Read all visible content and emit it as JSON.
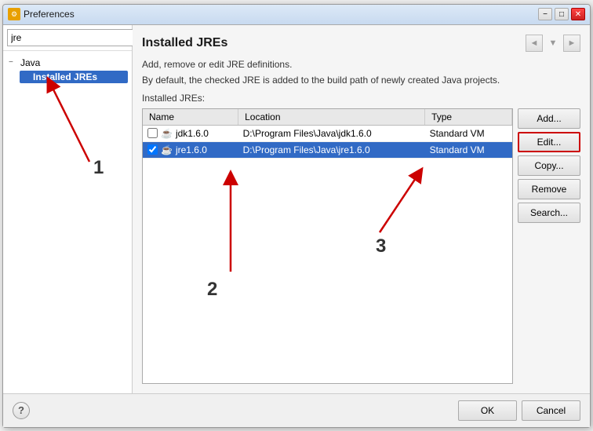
{
  "window": {
    "title": "Preferences",
    "icon": "⚙"
  },
  "titlebar": {
    "minimize_label": "−",
    "maximize_label": "□",
    "close_label": "✕"
  },
  "left_panel": {
    "search_value": "jre",
    "search_placeholder": "",
    "tree": {
      "java_label": "Java",
      "installed_jres_label": "Installed JREs",
      "expand_symbol": "−"
    }
  },
  "right_panel": {
    "title": "Installed JREs",
    "description_line1": "Add, remove or edit JRE definitions.",
    "description_line2": "By default, the checked JRE is added to the build path of newly created Java projects.",
    "installed_label": "Installed JREs:",
    "table": {
      "columns": [
        "Name",
        "Location",
        "Type"
      ],
      "rows": [
        {
          "checked": false,
          "name": "jdk1.6.0",
          "location": "D:\\Program Files\\Java\\jdk1.6.0",
          "type": "Standard VM",
          "selected": false
        },
        {
          "checked": true,
          "name": "jre1.6.0",
          "location": "D:\\Program Files\\Java\\jre1.6.0",
          "type": "Standard VM",
          "selected": true
        }
      ]
    },
    "buttons": {
      "add": "Add...",
      "edit": "Edit...",
      "copy": "Copy...",
      "remove": "Remove",
      "search": "Search..."
    }
  },
  "bottom_bar": {
    "help_symbol": "?",
    "ok_label": "OK",
    "cancel_label": "Cancel"
  },
  "annotations": {
    "num1": "1",
    "num2": "2",
    "num3": "3"
  },
  "nav": {
    "back": "◄",
    "forward": "►"
  }
}
